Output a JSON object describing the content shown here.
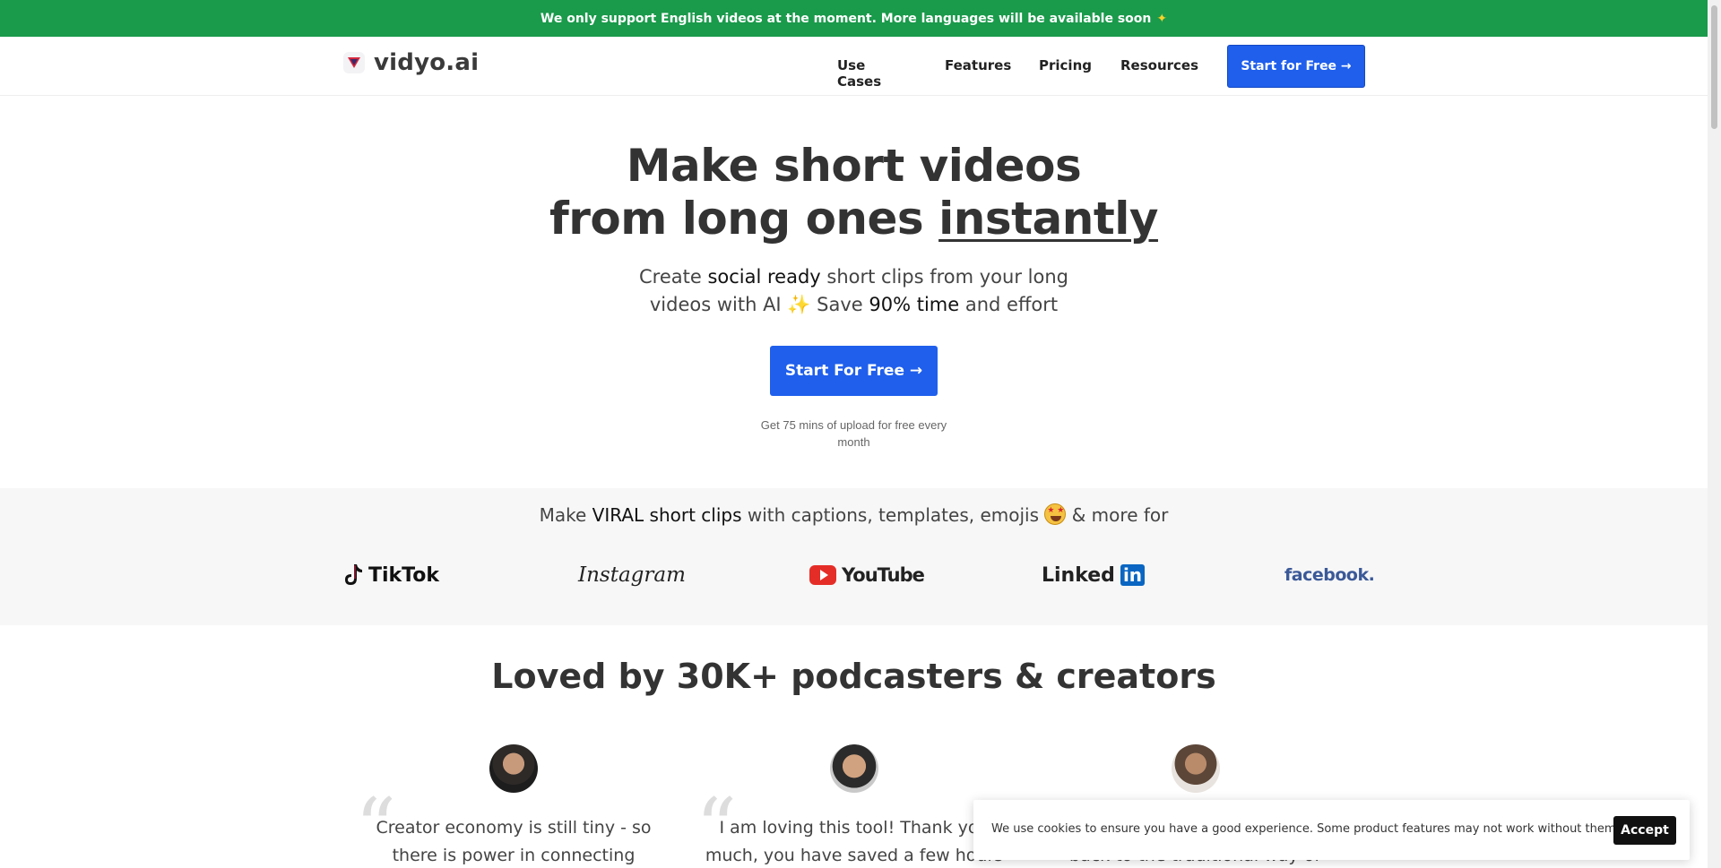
{
  "announcement": {
    "text": "We only support English videos at the moment. More languages will be available soon",
    "icon": "sparkle-icon"
  },
  "nav": {
    "brand": "vidyo.ai",
    "links": [
      "Use Cases",
      "Features",
      "Pricing",
      "Resources"
    ],
    "cta": "Start for Free →"
  },
  "hero": {
    "title_line1": "Make short videos",
    "title_line2_prefix": "from long ones ",
    "title_line2_underlined": "instantly",
    "sub_line1_a": "Create ",
    "sub_line1_b": "social ready",
    "sub_line1_c": " short clips from your long",
    "sub_line2_a": "videos with AI ",
    "sub_line2_b": " Save ",
    "sub_line2_c": "90% time",
    "sub_line2_d": " and effort",
    "cta": "Start For Free →",
    "note_line1": "Get 75 mins of upload for free every",
    "note_line2": "month"
  },
  "platforms": {
    "head_a": "Make ",
    "head_b": "VIRAL short clips",
    "head_c": " with captions, templates, emojis ",
    "head_d": " & more for",
    "logos": [
      "TikTok",
      "Instagram",
      "YouTube",
      "Linked",
      "in",
      "facebook."
    ]
  },
  "testimonials": {
    "heading": "Loved by 30K+ podcasters & creators",
    "quotes": [
      {
        "line1": "Creator economy is still tiny - so",
        "line2": "there is power in connecting"
      },
      {
        "line1": "I am loving this tool! Thank you",
        "line2": "much, you have saved a few hours"
      },
      {
        "line1": "back to the traditional way of"
      }
    ]
  },
  "cookie": {
    "text": "We use cookies to ensure you have a good experience. Some product features may not work without them.",
    "accept": "Accept"
  },
  "colors": {
    "announce_bg": "#1a9a4b",
    "primary": "#1f5fec"
  }
}
